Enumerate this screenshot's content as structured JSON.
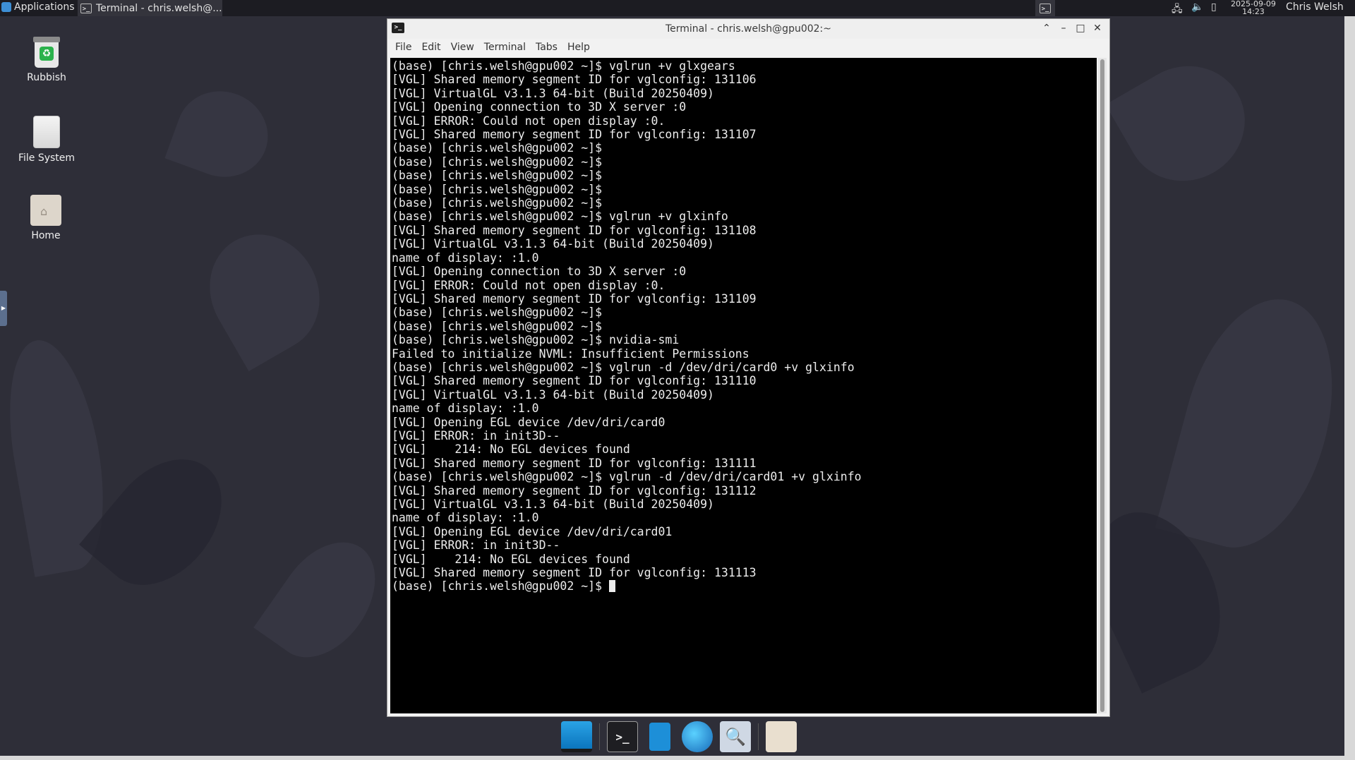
{
  "top_panel": {
    "applications_label": "Applications",
    "task_title": "Terminal - chris.welsh@...",
    "clock_date": "2025-09-09",
    "clock_time": "14:23",
    "user_name": "Chris Welsh"
  },
  "desktop": {
    "icons": [
      {
        "label": "Rubbish"
      },
      {
        "label": "File System"
      },
      {
        "label": "Home"
      }
    ]
  },
  "window": {
    "title": "Terminal - chris.welsh@gpu002:~",
    "menu": [
      "File",
      "Edit",
      "View",
      "Terminal",
      "Tabs",
      "Help"
    ],
    "terminal_output": "(base) [chris.welsh@gpu002 ~]$ vglrun +v glxgears\n[VGL] Shared memory segment ID for vglconfig: 131106\n[VGL] VirtualGL v3.1.3 64-bit (Build 20250409)\n[VGL] Opening connection to 3D X server :0\n[VGL] ERROR: Could not open display :0.\n[VGL] Shared memory segment ID for vglconfig: 131107\n(base) [chris.welsh@gpu002 ~]$\n(base) [chris.welsh@gpu002 ~]$\n(base) [chris.welsh@gpu002 ~]$\n(base) [chris.welsh@gpu002 ~]$\n(base) [chris.welsh@gpu002 ~]$\n(base) [chris.welsh@gpu002 ~]$ vglrun +v glxinfo\n[VGL] Shared memory segment ID for vglconfig: 131108\n[VGL] VirtualGL v3.1.3 64-bit (Build 20250409)\nname of display: :1.0\n[VGL] Opening connection to 3D X server :0\n[VGL] ERROR: Could not open display :0.\n[VGL] Shared memory segment ID for vglconfig: 131109\n(base) [chris.welsh@gpu002 ~]$\n(base) [chris.welsh@gpu002 ~]$\n(base) [chris.welsh@gpu002 ~]$ nvidia-smi\nFailed to initialize NVML: Insufficient Permissions\n(base) [chris.welsh@gpu002 ~]$ vglrun -d /dev/dri/card0 +v glxinfo\n[VGL] Shared memory segment ID for vglconfig: 131110\n[VGL] VirtualGL v3.1.3 64-bit (Build 20250409)\nname of display: :1.0\n[VGL] Opening EGL device /dev/dri/card0\n[VGL] ERROR: in init3D--\n[VGL]    214: No EGL devices found\n[VGL] Shared memory segment ID for vglconfig: 131111\n(base) [chris.welsh@gpu002 ~]$ vglrun -d /dev/dri/card01 +v glxinfo\n[VGL] Shared memory segment ID for vglconfig: 131112\n[VGL] VirtualGL v3.1.3 64-bit (Build 20250409)\nname of display: :1.0\n[VGL] Opening EGL device /dev/dri/card01\n[VGL] ERROR: in init3D--\n[VGL]    214: No EGL devices found\n[VGL] Shared memory segment ID for vglconfig: 131113",
    "prompt": "(base) [chris.welsh@gpu002 ~]$ "
  },
  "icons": {
    "apps": "applications-icon",
    "terminal": "terminal-icon",
    "network": "network-icon",
    "volume": "volume-icon",
    "battery": "battery-icon"
  },
  "colors": {
    "terminal_bg": "#000000",
    "terminal_fg": "#ededed",
    "panel_bg": "#1c1c22",
    "desktop_bg": "#2e2e38"
  }
}
